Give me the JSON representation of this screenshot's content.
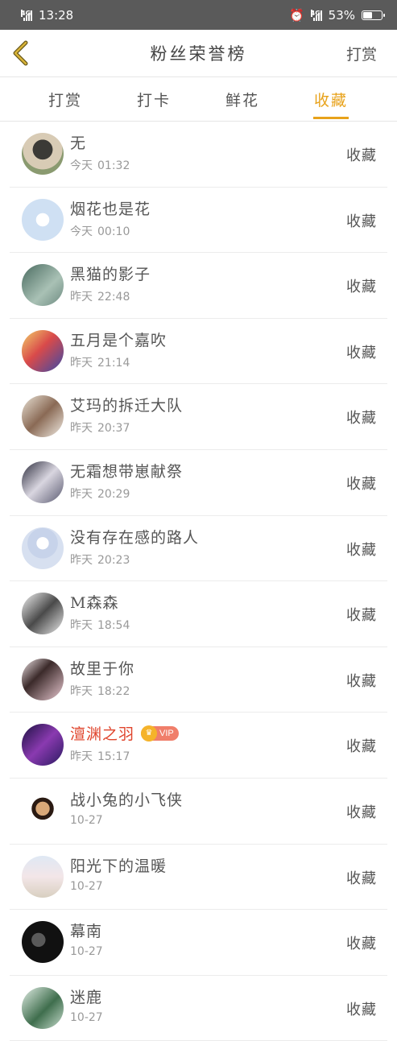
{
  "status_bar": {
    "network": "4G",
    "time": "13:28",
    "battery": "53%",
    "battery_level": 0.53
  },
  "nav": {
    "title": "粉丝荣誉榜",
    "right": "打赏"
  },
  "tabs": [
    {
      "label": "打赏",
      "active": false
    },
    {
      "label": "打卡",
      "active": false
    },
    {
      "label": "鲜花",
      "active": false
    },
    {
      "label": "收藏",
      "active": true
    }
  ],
  "accent_color": "#e8a21a",
  "fans": [
    {
      "name": "无",
      "day": "今天",
      "time": "01:32",
      "action": "收藏"
    },
    {
      "name": "烟花也是花",
      "day": "今天",
      "time": "00:10",
      "action": "收藏"
    },
    {
      "name": "黑猫的影子",
      "day": "昨天",
      "time": "22:48",
      "action": "收藏"
    },
    {
      "name": "五月是个嘉吹",
      "day": "昨天",
      "time": "21:14",
      "action": "收藏"
    },
    {
      "name": "艾玛的拆迁大队",
      "day": "昨天",
      "time": "20:37",
      "action": "收藏"
    },
    {
      "name": "无霜想带崽献祭",
      "day": "昨天",
      "time": "20:29",
      "action": "收藏"
    },
    {
      "name": "没有存在感的路人",
      "day": "昨天",
      "time": "20:23",
      "action": "收藏"
    },
    {
      "name": "M森森",
      "day": "昨天",
      "time": "18:54",
      "action": "收藏"
    },
    {
      "name": "故里于你",
      "day": "昨天",
      "time": "18:22",
      "action": "收藏"
    },
    {
      "name": "澶渊之羽",
      "day": "昨天",
      "time": "15:17",
      "action": "收藏",
      "vip": "VIP"
    },
    {
      "name": "战小兔的小飞侠",
      "day": "",
      "time": "10-27",
      "action": "收藏"
    },
    {
      "name": "阳光下的温暖",
      "day": "",
      "time": "10-27",
      "action": "收藏"
    },
    {
      "name": "幕南",
      "day": "",
      "time": "10-27",
      "action": "收藏"
    },
    {
      "name": "迷鹿",
      "day": "",
      "time": "10-27",
      "action": "收藏"
    }
  ]
}
